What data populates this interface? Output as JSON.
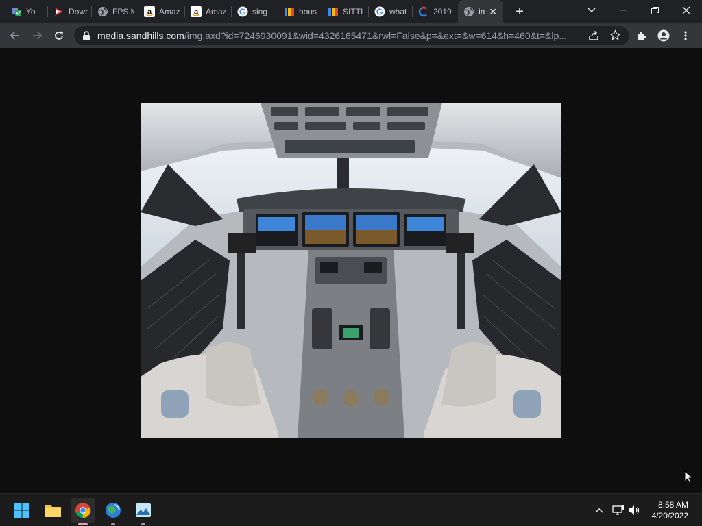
{
  "browser": {
    "tabs": [
      {
        "title": "Yo",
        "favicon": "discord-check-icon",
        "width": 62
      },
      {
        "title": "Dowr",
        "favicon": "download-arrow-icon",
        "width": 64
      },
      {
        "title": "FPS M",
        "favicon": "globe-icon",
        "width": 68
      },
      {
        "title": "Amaz",
        "favicon": "amazon-icon",
        "width": 68
      },
      {
        "title": "Amaz",
        "favicon": "amazon-icon",
        "width": 68
      },
      {
        "title": "sing",
        "favicon": "google-icon",
        "width": 68
      },
      {
        "title": "hous",
        "favicon": "bars-icon",
        "width": 64
      },
      {
        "title": "SITTI",
        "favicon": "bars-icon",
        "width": 68
      },
      {
        "title": "what",
        "favicon": "google-icon",
        "width": 64
      },
      {
        "title": "2019",
        "favicon": "c-logo-icon",
        "width": 66
      },
      {
        "title": "in",
        "favicon": "globe-icon",
        "width": 66,
        "active": true
      }
    ],
    "url_host": "media.sandhills.com",
    "url_rest": "/img.axd?id=7246930091&wid=4326165471&rwl=False&p=&ext=&w=614&h=460&t=&lp..."
  },
  "taskbar": {
    "time": "8:58 AM",
    "date": "4/20/2022"
  }
}
